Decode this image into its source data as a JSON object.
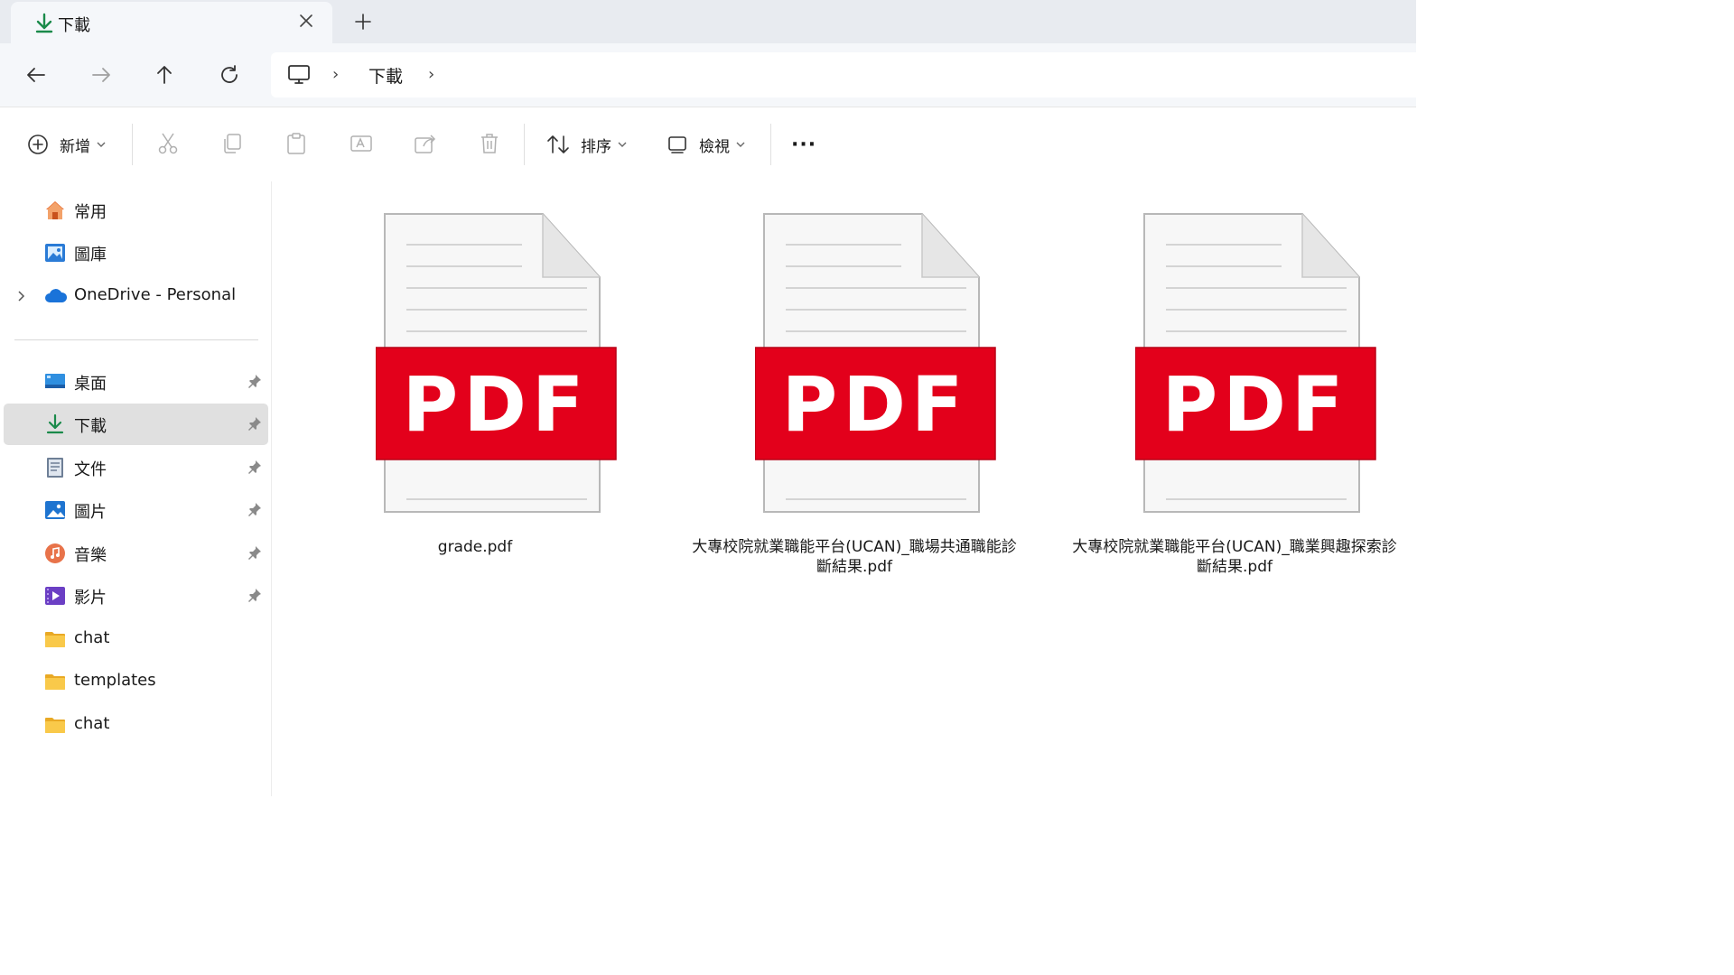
{
  "tab": {
    "title": "下載",
    "close_glyph": "✕",
    "new_tab_glyph": "+"
  },
  "nav": {
    "back": "back-arrow-icon",
    "forward": "forward-arrow-icon",
    "up": "up-arrow-icon",
    "refresh": "refresh-icon"
  },
  "address": {
    "root_icon": "this-pc-icon",
    "segments": [
      "下載"
    ],
    "separator": "›"
  },
  "commandbar": {
    "new_label": "新增",
    "sort_label": "排序",
    "view_label": "檢視",
    "more_glyph": "···"
  },
  "sidebar": {
    "quick": [
      {
        "label": "常用",
        "icon": "home-icon"
      },
      {
        "label": "圖庫",
        "icon": "gallery-icon"
      },
      {
        "label": "OneDrive - Personal",
        "icon": "onedrive-cloud-icon"
      }
    ],
    "pinned": [
      {
        "label": "桌面",
        "icon": "desktop-icon"
      },
      {
        "label": "下載",
        "icon": "download-icon"
      },
      {
        "label": "文件",
        "icon": "documents-icon"
      },
      {
        "label": "圖片",
        "icon": "pictures-icon"
      },
      {
        "label": "音樂",
        "icon": "music-icon"
      },
      {
        "label": "影片",
        "icon": "videos-icon"
      }
    ],
    "folders": [
      {
        "label": "chat",
        "icon": "folder-icon"
      },
      {
        "label": "templates",
        "icon": "folder-icon"
      },
      {
        "label": "chat",
        "icon": "folder-icon"
      }
    ]
  },
  "files": [
    {
      "name_line1": "grade.pdf",
      "name_line2": "",
      "badge": "PDF"
    },
    {
      "name_line1": "大專校院就業職能平台(UCAN)_職場共通職能診",
      "name_line2": "斷結果.pdf",
      "badge": "PDF"
    },
    {
      "name_line1": "大專校院就業職能平台(UCAN)_職業興趣探索診",
      "name_line2": "斷結果.pdf",
      "badge": "PDF"
    }
  ],
  "colors": {
    "pdf_red": "#e3001b",
    "download_green": "#1a8a4a",
    "folder_yellow": "#f4c245",
    "selected_bg": "#e0e0e0"
  }
}
